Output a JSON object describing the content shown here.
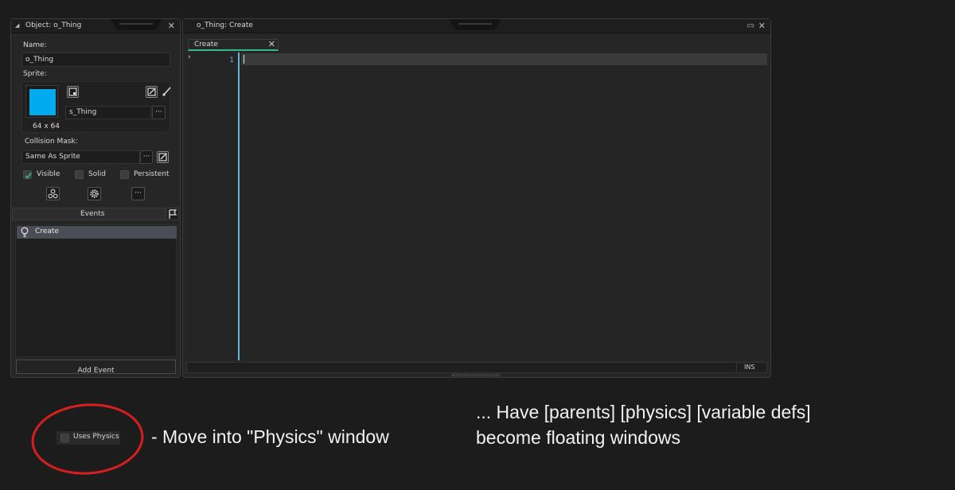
{
  "object_window": {
    "title": "Object: o_Thing",
    "name_label": "Name:",
    "name_value": "o_Thing",
    "sprite_label": "Sprite:",
    "sprite_size": "64 x 64",
    "sprite_name": "s_Thing",
    "sprite_color": "#00aaee",
    "collision_label": "Collision Mask:",
    "collision_value": "Same As Sprite",
    "more_label": "···",
    "checkboxes": [
      {
        "label": "Visible",
        "checked": true
      },
      {
        "label": "Solid",
        "checked": false
      },
      {
        "label": "Persistent",
        "checked": false
      }
    ],
    "events_header": "Events",
    "events": [
      {
        "label": "Create",
        "icon": "lightbulb-icon"
      }
    ],
    "add_event_label": "Add Event"
  },
  "code_window": {
    "title": "o_Thing: Create",
    "tab_label": "Create",
    "line_number": "1",
    "status_mode": "INS"
  },
  "annotation": {
    "uses_physics_label": "Uses Physics",
    "note_left": "- Move into \"Physics\" window",
    "note_right_line1": "... Have [parents] [physics] [variable defs]",
    "note_right_line2": "become floating windows",
    "circle_color": "#d81e1e"
  },
  "colors": {
    "accent_green": "#2fbd8c",
    "line_number_color": "#5fb7d9",
    "selection": "#4a4d55"
  }
}
